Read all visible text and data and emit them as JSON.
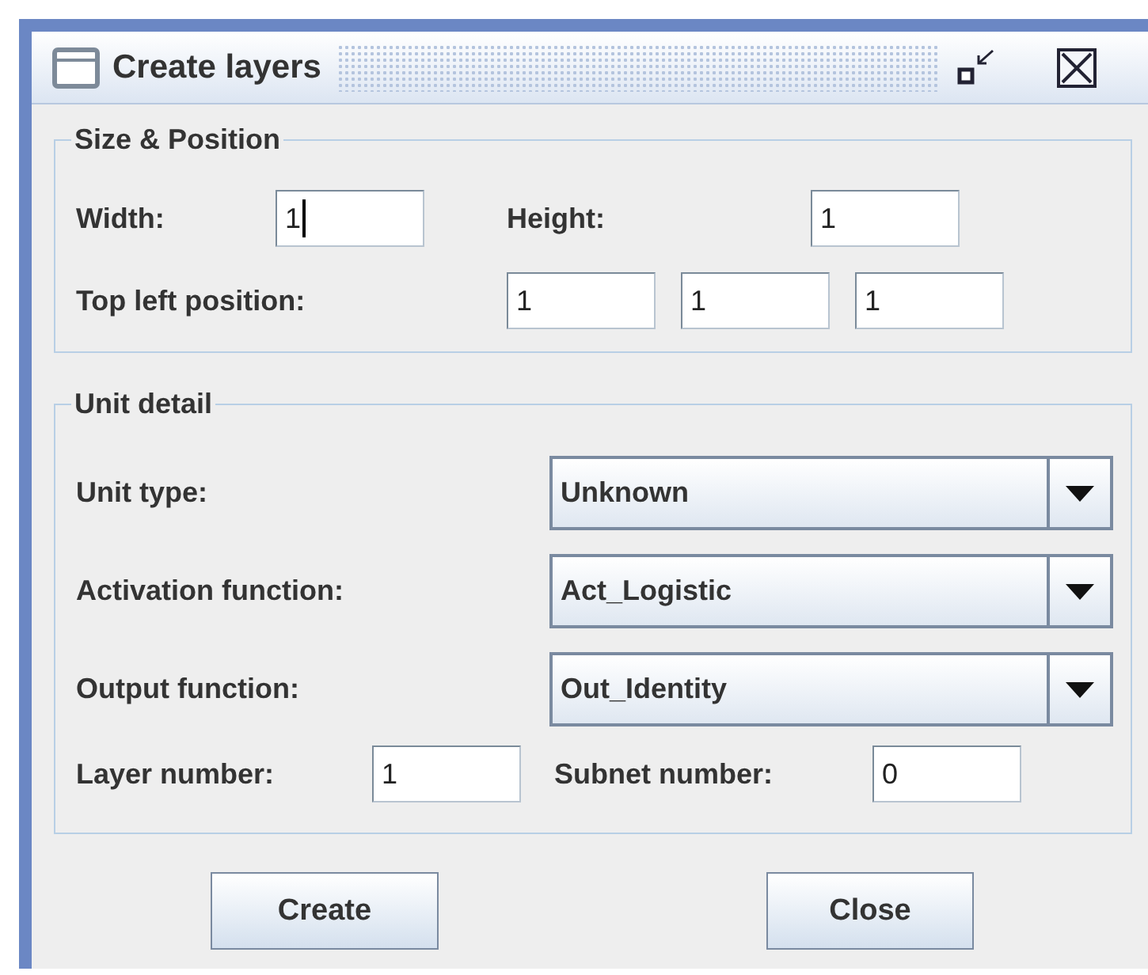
{
  "window": {
    "title": "Create layers"
  },
  "size_position": {
    "legend": "Size & Position",
    "width": {
      "label": "Width:",
      "value": "1",
      "focused": true
    },
    "height": {
      "label": "Height:",
      "value": "1",
      "focused": false
    },
    "top_left": {
      "label": "Top left position:",
      "values": [
        "1",
        "1",
        "1"
      ]
    }
  },
  "unit_detail": {
    "legend": "Unit detail",
    "combos": [
      {
        "label": "Unit type:",
        "value": "Unknown"
      },
      {
        "label": "Activation function:",
        "value": "Act_Logistic"
      },
      {
        "label": "Output function:",
        "value": "Out_Identity"
      }
    ],
    "layer_number": {
      "label": "Layer number:",
      "value": "1"
    },
    "subnet_number": {
      "label": "Subnet number:",
      "value": "0"
    }
  },
  "buttons": [
    "Create",
    "Close"
  ]
}
